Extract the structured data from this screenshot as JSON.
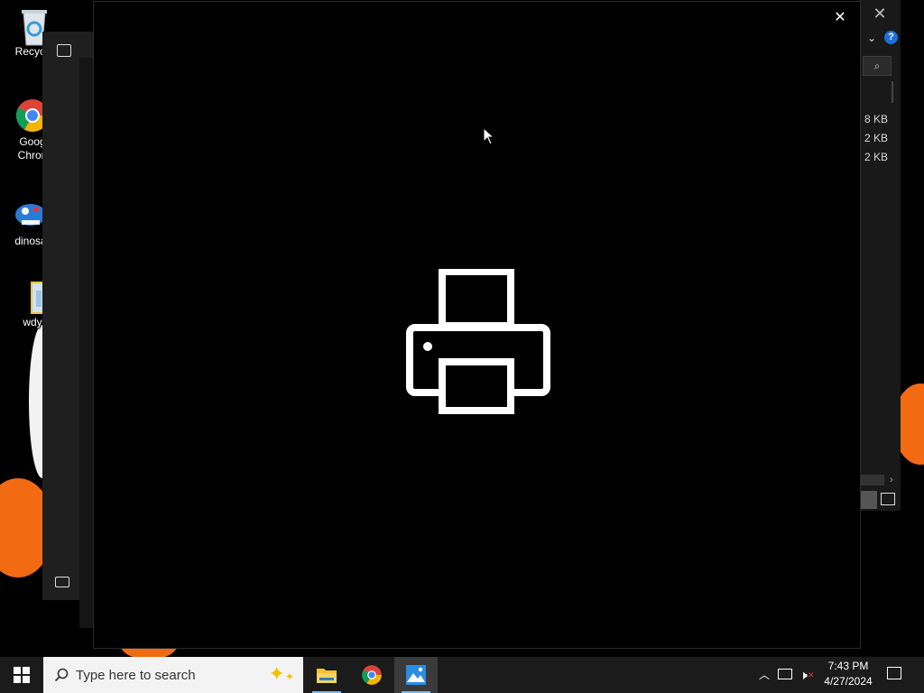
{
  "desktop": {
    "icons": [
      {
        "label": "Recycle",
        "icon": "recycle-bin-icon"
      },
      {
        "label": "Goog\nChron",
        "icon": "chrome-icon"
      },
      {
        "label": "dinosa",
        "icon": "dinosaur-icon"
      },
      {
        "label": "wdy",
        "icon": "folder-icon"
      }
    ]
  },
  "explorer_window": {
    "file_sizes": [
      "8 KB",
      "2 KB",
      "2 KB"
    ]
  },
  "viewer": {
    "placeholder_icon": "printer-icon"
  },
  "taskbar": {
    "search_placeholder": "Type here to search",
    "apps": [
      {
        "name": "File Explorer",
        "icon": "file-explorer-icon"
      },
      {
        "name": "Google Chrome",
        "icon": "chrome-icon"
      },
      {
        "name": "Photos",
        "icon": "photos-icon",
        "active": true
      }
    ],
    "clock": {
      "time": "7:43 PM",
      "date": "4/27/2024"
    }
  },
  "colors": {
    "accent": "#76b9ed",
    "help_badge": "#1e6fd6",
    "wallpaper_orange": "#f26a12"
  }
}
